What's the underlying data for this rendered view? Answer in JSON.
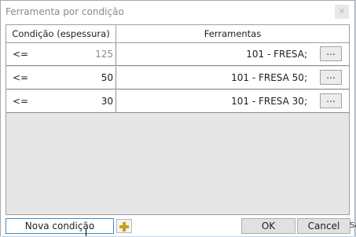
{
  "window": {
    "title": "Ferramenta por condição",
    "close_glyph": "×"
  },
  "grid": {
    "columns": [
      "Condição (espessura)",
      "Ferramentas"
    ],
    "rows": [
      {
        "operator": "<=",
        "value": "125",
        "tool": "101 - FRESA;",
        "browse": "..."
      },
      {
        "operator": "<=",
        "value": "50",
        "tool": "101 - FRESA 50;",
        "browse": "..."
      },
      {
        "operator": "<=",
        "value": "30",
        "tool": "101 - FRESA 30;",
        "browse": "..."
      }
    ]
  },
  "footer": {
    "new_condition_label": "Nova condição",
    "add_icon": "plus-icon",
    "ok_label": "OK",
    "cancel_label": "Cancel"
  },
  "background": {
    "fragment_1": "Sa"
  },
  "colors": {
    "focus_border": "#3c8fcf",
    "plus_icon": "#c8a020"
  }
}
